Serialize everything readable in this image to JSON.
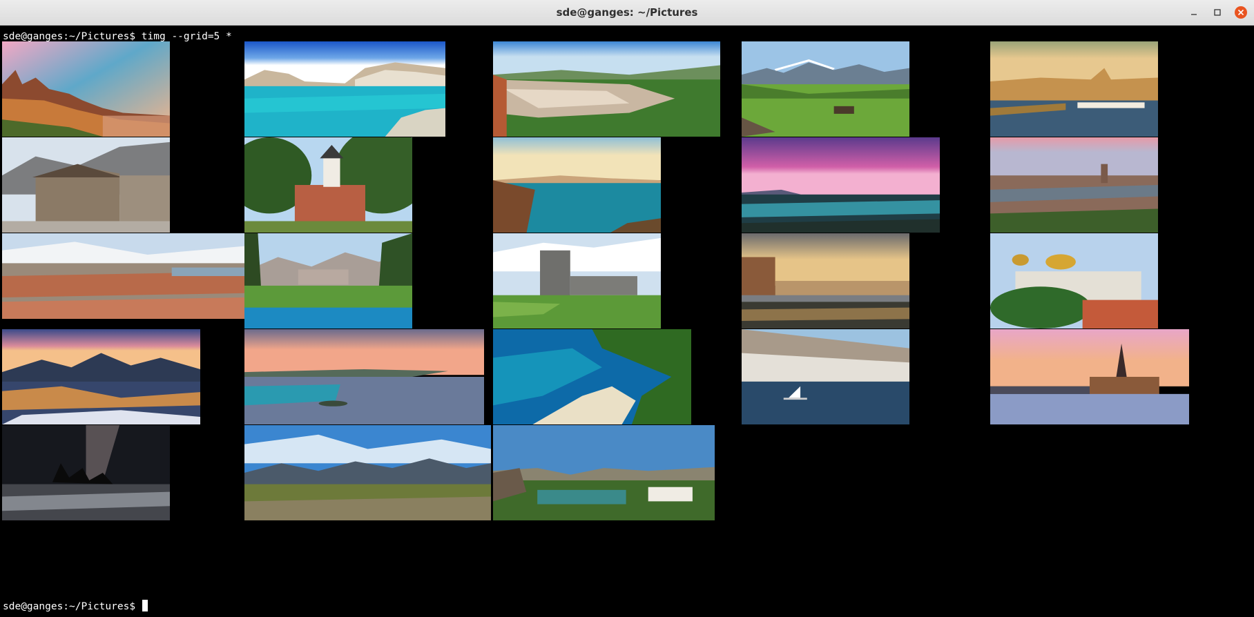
{
  "window": {
    "title": "sde@ganges: ~/Pictures",
    "controls": {
      "minimize": "minimize-icon",
      "maximize": "maximize-icon",
      "close": "close-icon"
    },
    "colors": {
      "close_button": "#e95420",
      "titlebar": "#e4e4e4",
      "terminal_bg": "#000000",
      "terminal_fg": "#ffffff"
    }
  },
  "terminal": {
    "command_prompt": "sde@ganges:~/Pictures$ ",
    "command": "timg --grid=5 *",
    "final_prompt": "sde@ganges:~/Pictures$ ",
    "grid_columns": 5,
    "image_count": 23,
    "images": [
      "old-town-waterfront-sunset",
      "turquoise-harbor-village",
      "hillside-town-green-valley",
      "alpine-meadow-chalets",
      "river-city-bridge-golden-hour",
      "stone-house-mountains",
      "church-between-trees",
      "rocky-coast-blue-sea",
      "purple-sunset-lake",
      "city-rooftops-dome-sunset",
      "aerial-city-panorama",
      "mountain-lake-cabin",
      "castle-on-green-hill",
      "bridge-river-city-cloudy",
      "golden-dome-cathedral",
      "snowy-mountains-sunrise",
      "coastal-town-pink-sunset",
      "aerial-turquoise-beach",
      "hillside-town-sailboat",
      "stockholm-spire-sunset",
      "milky-way-sea-stacks",
      "mountain-valley-panorama",
      "lake-town-mountains"
    ]
  }
}
